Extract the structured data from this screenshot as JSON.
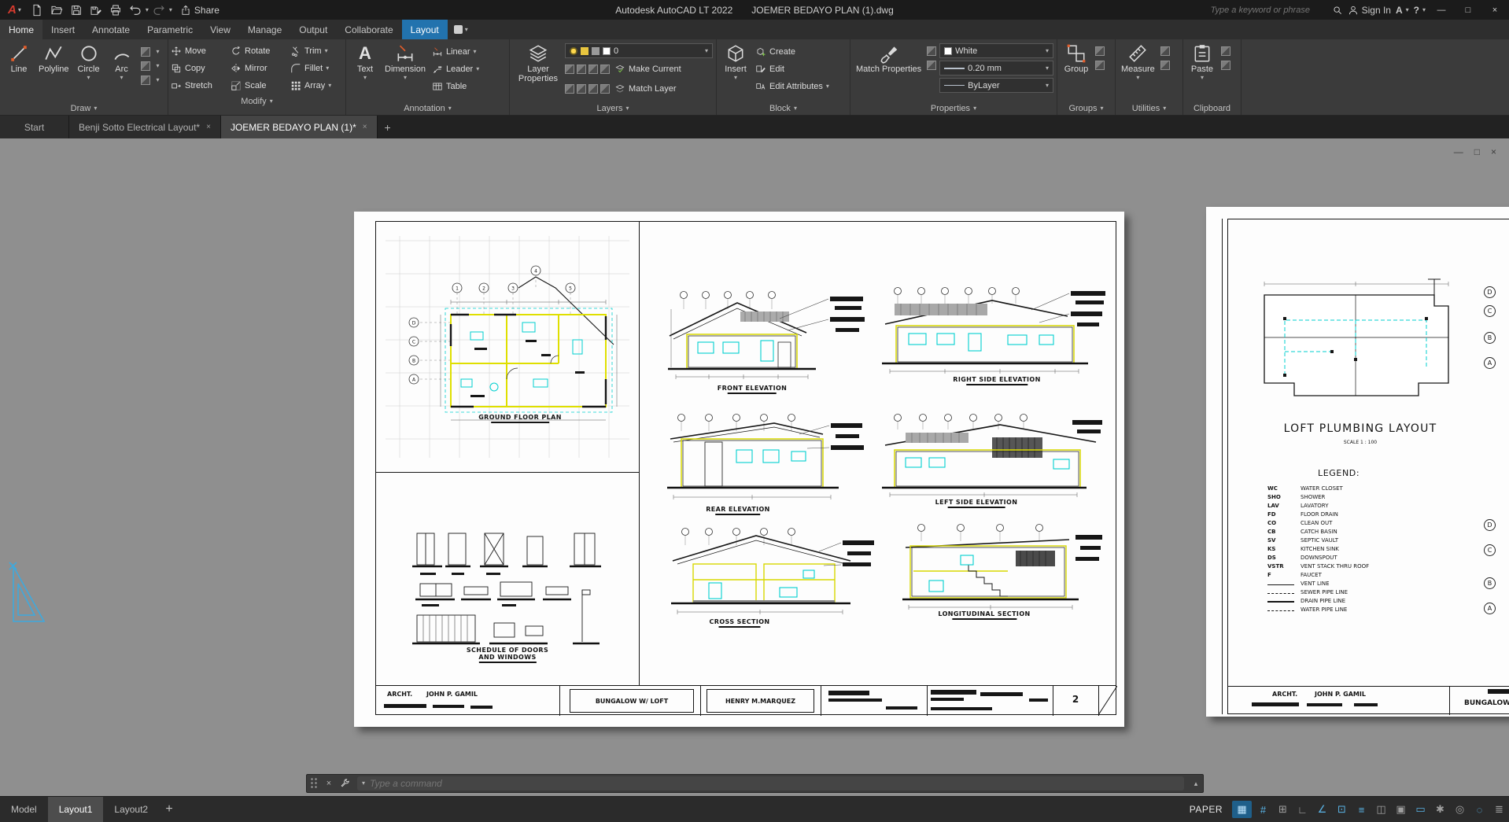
{
  "titlebar": {
    "share": "Share",
    "app_title": "Autodesk AutoCAD LT 2022",
    "doc_title": "JOEMER BEDAYO PLAN (1).dwg",
    "search_placeholder": "Type a keyword or phrase",
    "sign_in": "Sign In"
  },
  "icons": {
    "caret": "▾",
    "close": "×",
    "minimize": "—",
    "maximize": "□",
    "plus": "+",
    "up": "▴",
    "help": "?",
    "logo_letter": "A",
    "autodesk_a": "A"
  },
  "ribbon_tabs": {
    "tabs": [
      "Home",
      "Insert",
      "Annotate",
      "Parametric",
      "View",
      "Manage",
      "Output",
      "Collaborate",
      "Layout"
    ]
  },
  "ribbon": {
    "draw": {
      "label": "Draw",
      "line": "Line",
      "polyline": "Polyline",
      "circle": "Circle",
      "arc": "Arc"
    },
    "modify": {
      "label": "Modify",
      "move": "Move",
      "rotate": "Rotate",
      "trim": "Trim",
      "copy": "Copy",
      "mirror": "Mirror",
      "fillet": "Fillet",
      "stretch": "Stretch",
      "scale": "Scale",
      "array": "Array"
    },
    "annotation": {
      "label": "Annotation",
      "text": "Text",
      "dimension": "Dimension",
      "linear": "Linear",
      "leader": "Leader",
      "table": "Table"
    },
    "layers": {
      "label": "Layers",
      "layer_properties": "Layer Properties",
      "current_layer": "0",
      "make_current": "Make Current",
      "match_layer": "Match Layer"
    },
    "block": {
      "label": "Block",
      "insert": "Insert",
      "create": "Create",
      "edit": "Edit",
      "edit_attributes": "Edit Attributes"
    },
    "properties": {
      "label": "Properties",
      "match_properties": "Match Properties",
      "color": "White",
      "lineweight": "0.20 mm",
      "linetype": "ByLayer"
    },
    "groups": {
      "label": "Groups",
      "group": "Group"
    },
    "utilities": {
      "label": "Utilities",
      "measure": "Measure"
    },
    "clipboard": {
      "label": "Clipboard",
      "paste": "Paste"
    }
  },
  "file_tabs": {
    "start": "Start",
    "tab1": "Benji Sotto Electrical Layout*",
    "tab2": "JOEMER BEDAYO PLAN (1)*"
  },
  "sheet1": {
    "grid_bubble_numbers": [
      "1",
      "2",
      "3",
      "4",
      "5"
    ],
    "grid_bubble_letters": [
      "D",
      "C",
      "B",
      "A"
    ],
    "labels": {
      "ground_floor_plan": "GROUND FLOOR PLAN",
      "schedule": "SCHEDULE OF DOORS\nAND WINDOWS",
      "front_elevation": "FRONT ELEVATION",
      "rear_elevation": "REAR ELEVATION",
      "cross_section": "CROSS SECTION",
      "right_side_elevation": "RIGHT SIDE ELEVATION",
      "left_side_elevation": "LEFT SIDE ELEVATION",
      "longitudinal_section": "LONGITUDINAL SECTION"
    },
    "titleblock": {
      "archt_label": "ARCHT.",
      "architect": "JOHN P. GAMIL",
      "project": "BUNGALOW W/ LOFT",
      "owner": "HENRY M.MARQUEZ",
      "sheet_no": "2"
    }
  },
  "sheet2": {
    "title": "LOFT PLUMBING LAYOUT",
    "scale": "SCALE   1 : 100",
    "legend_title": "LEGEND:",
    "bubble_letters": [
      "D",
      "C",
      "B",
      "A"
    ],
    "legend": [
      {
        "abbr": "WC",
        "name": "WATER CLOSET"
      },
      {
        "abbr": "SHO",
        "name": "SHOWER"
      },
      {
        "abbr": "LAV",
        "name": "LAVATORY"
      },
      {
        "abbr": "FD",
        "name": "FLOOR DRAIN"
      },
      {
        "abbr": "CO",
        "name": "CLEAN OUT"
      },
      {
        "abbr": "CB",
        "name": "CATCH BASIN"
      },
      {
        "abbr": "SV",
        "name": "SEPTIC VAULT"
      },
      {
        "abbr": "KS",
        "name": "KITCHEN SINK"
      },
      {
        "abbr": "DS",
        "name": "DOWNSPOUT"
      },
      {
        "abbr": "VSTR",
        "name": "VENT STACK THRU ROOF"
      },
      {
        "abbr": "F",
        "name": "FAUCET"
      },
      {
        "abbr": "",
        "name": "VENT LINE"
      },
      {
        "abbr": "",
        "name": "SEWER PIPE LINE"
      },
      {
        "abbr": "",
        "name": "DRAIN PIPE LINE"
      },
      {
        "abbr": "",
        "name": "WATER PIPE LINE"
      }
    ],
    "titleblock": {
      "archt_label": "ARCHT.",
      "architect": "JOHN P. GAMIL",
      "project": "BUNGALOW W"
    }
  },
  "command_line": {
    "placeholder": "Type a command"
  },
  "statusbar": {
    "model": "Model",
    "layout1": "Layout1",
    "layout2": "Layout2",
    "paper": "PAPER",
    "icons": [
      {
        "name": "paper-space-icon",
        "glyph": "▦"
      },
      {
        "name": "grid-icon",
        "glyph": "#"
      },
      {
        "name": "snap-icon",
        "glyph": "⊞"
      },
      {
        "name": "ortho-icon",
        "glyph": "∟"
      },
      {
        "name": "polar-tracking-icon",
        "glyph": "∠"
      },
      {
        "name": "osnap-icon",
        "glyph": "⊡"
      },
      {
        "name": "lineweight-icon",
        "glyph": "≡"
      },
      {
        "name": "transparency-icon",
        "glyph": "◫"
      },
      {
        "name": "selection-cycling-icon",
        "glyph": "▣"
      },
      {
        "name": "annotation-scale-icon",
        "glyph": "▭"
      },
      {
        "name": "workspace-icon",
        "glyph": "✱"
      },
      {
        "name": "annotation-monitor-icon",
        "glyph": "◎"
      },
      {
        "name": "isolate-icon",
        "glyph": "◌"
      },
      {
        "name": "customize-icon",
        "glyph": "≣"
      }
    ]
  },
  "colors": {
    "accent_blue": "#2273ae",
    "wall_yellow": "#e3e300",
    "fixture_cyan": "#00cfcf",
    "canvas_gray": "#8f8f8f"
  }
}
